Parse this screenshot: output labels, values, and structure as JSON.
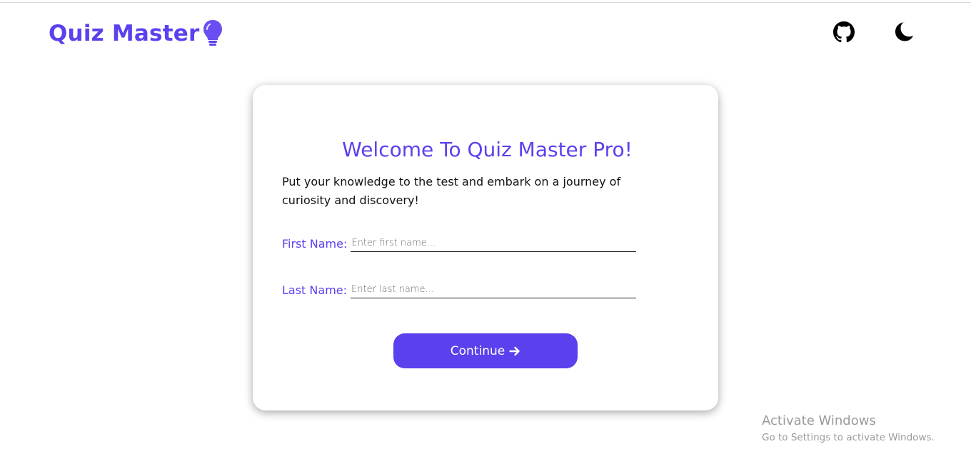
{
  "header": {
    "logo_text": "Quiz Master",
    "logo_icon": "lightbulb-icon",
    "github_icon": "github-icon",
    "theme_icon": "moon-icon"
  },
  "card": {
    "title": "Welcome To Quiz Master Pro!",
    "subtitle": "Put your knowledge to the test and embark on a journey of curiosity and discovery!",
    "first_name": {
      "label": "First Name:",
      "value": "",
      "placeholder": "Enter first name..."
    },
    "last_name": {
      "label": "Last Name:",
      "value": "",
      "placeholder": "Enter last name..."
    },
    "continue_label": "Continue",
    "continue_icon": "arrow-right-icon"
  },
  "watermark": {
    "title": "Activate Windows",
    "subtitle": "Go to Settings to activate Windows."
  },
  "colors": {
    "accent": "#5a41ee",
    "text": "#111111",
    "background": "#ffffff"
  }
}
